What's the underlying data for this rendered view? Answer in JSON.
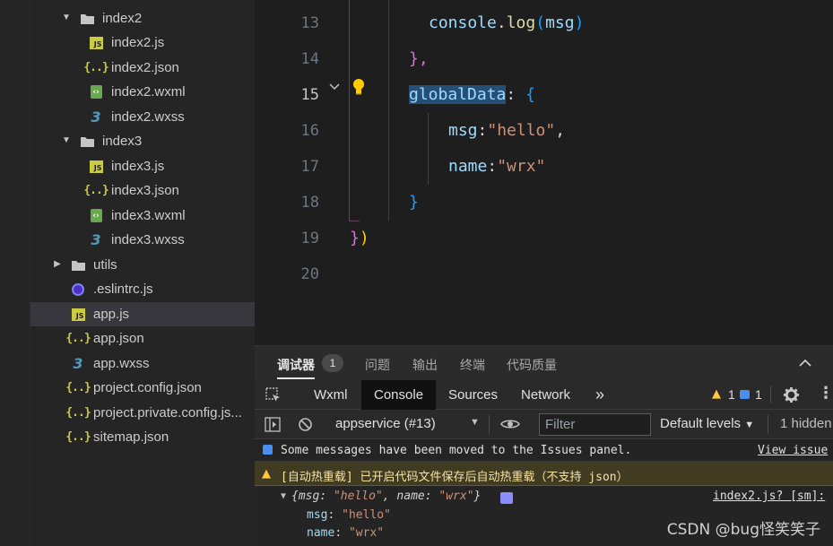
{
  "explorer": {
    "items": [
      {
        "label": "index2",
        "kind": "folder",
        "expanded": true
      },
      {
        "label": "index2.js",
        "kind": "js"
      },
      {
        "label": "index2.json",
        "kind": "json"
      },
      {
        "label": "index2.wxml",
        "kind": "wxml"
      },
      {
        "label": "index2.wxss",
        "kind": "wxss"
      },
      {
        "label": "index3",
        "kind": "folder",
        "expanded": true
      },
      {
        "label": "index3.js",
        "kind": "js"
      },
      {
        "label": "index3.json",
        "kind": "json"
      },
      {
        "label": "index3.wxml",
        "kind": "wxml"
      },
      {
        "label": "index3.wxss",
        "kind": "wxss"
      },
      {
        "label": "utils",
        "kind": "folder",
        "expanded": false
      },
      {
        "label": ".eslintrc.js",
        "kind": "eslint"
      },
      {
        "label": "app.js",
        "kind": "js",
        "selected": true
      },
      {
        "label": "app.json",
        "kind": "json"
      },
      {
        "label": "app.wxss",
        "kind": "wxss"
      },
      {
        "label": "project.config.json",
        "kind": "json"
      },
      {
        "label": "project.private.config.js...",
        "kind": "json"
      },
      {
        "label": "sitemap.json",
        "kind": "json"
      }
    ]
  },
  "editor": {
    "line_numbers": [
      "13",
      "14",
      "15",
      "16",
      "17",
      "18",
      "19",
      "20"
    ],
    "active_line": "15",
    "code": {
      "l13_obj": "console",
      "l13_dot": ".",
      "l13_fn": "log",
      "l13_open": "(",
      "l13_arg": "msg",
      "l13_close": ")",
      "l14": "},",
      "l15_key": "globalData",
      "l15_colon": ": ",
      "l15_brace": "{",
      "l16_key": "msg",
      "l16_colon": ":",
      "l16_val": "\"hello\"",
      "l16_comma": ",",
      "l17_key": "name",
      "l17_colon": ":",
      "l17_val": "\"wrx\"",
      "l18": "}",
      "l19_brace": "}",
      "l19_paren": ")"
    },
    "lightbulb_icon": "lightbulb-icon",
    "fold_icon": "chevron-down-icon"
  },
  "debugger": {
    "tabs": [
      "调试器",
      "问题",
      "输出",
      "终端",
      "代码质量"
    ],
    "debugger_count": "1",
    "devtools_tabs": [
      "Wxml",
      "Console",
      "Sources",
      "Network"
    ],
    "active_devtools_tab": "Console",
    "more_tabs": "»",
    "warn_count": "1",
    "info_count": "1",
    "context": "appservice (#13)",
    "filter_placeholder": "Filter",
    "levels": "Default levels",
    "hidden": "1 hidden",
    "messages": {
      "info_text": "Some messages have been moved to the Issues panel.",
      "info_link": "View issue",
      "warn_text": "[自动热重载] 已开启代码文件保存后自动热重载（不支持 json）",
      "obj_open": "{",
      "obj_k1": "msg",
      "obj_v1": "\"hello\"",
      "obj_sep": ", ",
      "obj_k2": "name",
      "obj_v2": "\"wrx\"",
      "obj_close": "}",
      "obj_source": "index2.js? [sm]:",
      "prop1_key": "msg",
      "prop1_val": "\"hello\"",
      "prop2_key": "name",
      "prop2_val": "\"wrx\""
    }
  },
  "watermark": "CSDN @bug怪笑笑子",
  "colors": {
    "accent_blue": "#264f78",
    "warn_bg": "#413b22",
    "string": "#ce9178",
    "property": "#9cdcfe"
  }
}
